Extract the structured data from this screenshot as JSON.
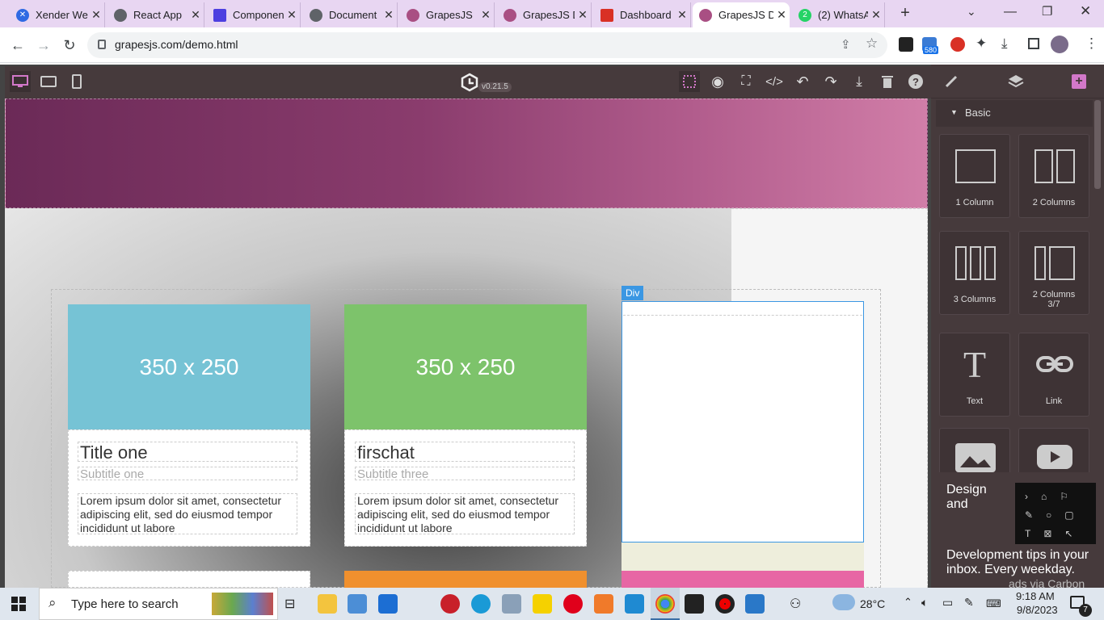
{
  "browser": {
    "tabs": [
      {
        "title": "Xender We",
        "color": "#2f6ae3"
      },
      {
        "title": "React App",
        "color": "#5f6368"
      },
      {
        "title": "Componen",
        "color": "#4d3fe0"
      },
      {
        "title": "Document",
        "color": "#5f6368"
      },
      {
        "title": "GrapesJS",
        "color": "#a94f83"
      },
      {
        "title": "GrapesJS D",
        "color": "#a94f83"
      },
      {
        "title": "Dashboard",
        "color": "#d93025"
      },
      {
        "title": "GrapesJS D",
        "color": "#a94f83"
      },
      {
        "title": "(2) WhatsA",
        "color": "#25d366"
      }
    ],
    "whatsapp_count": "2",
    "url": "grapesjs.com/demo.html",
    "ext_badge": "580"
  },
  "editor": {
    "version": "v0.21.5",
    "cards": [
      {
        "img": "350 x 250",
        "title": "Title one",
        "subtitle": "Subtitle one",
        "text": "Lorem ipsum dolor sit amet, consectetur adipiscing elit, sed do eiusmod tempor incididunt ut labore",
        "color": "#76c3d5"
      },
      {
        "img": "350 x 250",
        "title": "firschat",
        "subtitle": "Subtitle three",
        "text": "Lorem ipsum dolor sit amet, consectetur adipiscing elit, sed do eiusmod tempor incididunt ut labore",
        "color": "#7dc36b"
      }
    ],
    "selected_badge": "Div",
    "row2_colors": [
      "#f0902e",
      "#e766a4"
    ]
  },
  "panel": {
    "section": "Basic",
    "blocks": [
      "1 Column",
      "2 Columns",
      "3 Columns",
      "2 Columns 3/7",
      "Text",
      "Link"
    ],
    "ad_title": "Design and",
    "ad_text": "Development tips in your inbox. Every weekday.",
    "ad_credit": "ads via Carbon"
  },
  "taskbar": {
    "search_placeholder": "Type here to search",
    "temperature": "28°C",
    "time": "9:18 AM",
    "date": "9/8/2023",
    "notifications": "7"
  }
}
